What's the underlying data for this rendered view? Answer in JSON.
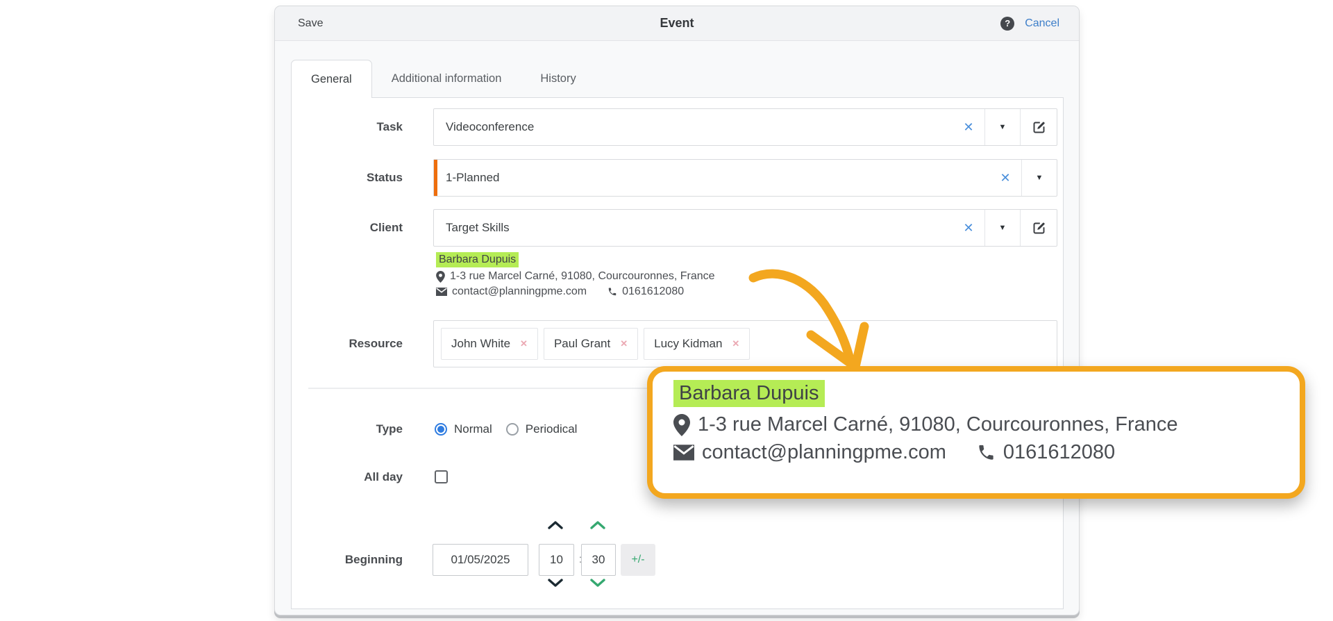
{
  "glyphs": {
    "help": "?",
    "clear": "✕",
    "dropdown": "▼",
    "remove_tag": "✕",
    "time_separator": ":"
  },
  "colors": {
    "status_accent": "#ee6e0d",
    "highlight_green": "#b5ec55",
    "callout_orange": "#f3a71f",
    "link_blue": "#3d7ec9",
    "clear_blue": "#4a8fdb",
    "radio_blue": "#2f7ce0",
    "stepper_green": "#35a870",
    "stepper_dark": "#1b2a32",
    "tag_remove_pink": "#eba9b3"
  },
  "dialog": {
    "header": {
      "save_label": "Save",
      "title": "Event",
      "cancel_label": "Cancel"
    },
    "tabs": [
      {
        "label": "General",
        "active": true
      },
      {
        "label": "Additional information",
        "active": false
      },
      {
        "label": "History",
        "active": false
      }
    ],
    "form": {
      "task": {
        "label": "Task",
        "value": "Videoconference"
      },
      "status": {
        "label": "Status",
        "value": "1-Planned"
      },
      "client": {
        "label": "Client",
        "value": "Target Skills",
        "info": {
          "name": "Barbara Dupuis",
          "address": "1-3 rue Marcel Carné, 91080, Courcouronnes, France",
          "email": "contact@planningpme.com",
          "phone": "0161612080"
        }
      },
      "resource": {
        "label": "Resource",
        "tags": [
          {
            "name": "John White"
          },
          {
            "name": "Paul Grant"
          },
          {
            "name": "Lucy Kidman"
          }
        ]
      },
      "type": {
        "label": "Type",
        "options": [
          {
            "label": "Normal",
            "selected": true
          },
          {
            "label": "Periodical",
            "selected": false
          }
        ]
      },
      "all_day": {
        "label": "All day",
        "checked": false
      },
      "beginning": {
        "label": "Beginning",
        "date": "01/05/2025",
        "hour": "10",
        "minute": "30",
        "plus_minus_label": "+/-"
      }
    }
  },
  "callout": {
    "name": "Barbara Dupuis",
    "address": "1-3 rue Marcel Carné, 91080, Courcouronnes, France",
    "email": "contact@planningpme.com",
    "phone": "0161612080"
  }
}
